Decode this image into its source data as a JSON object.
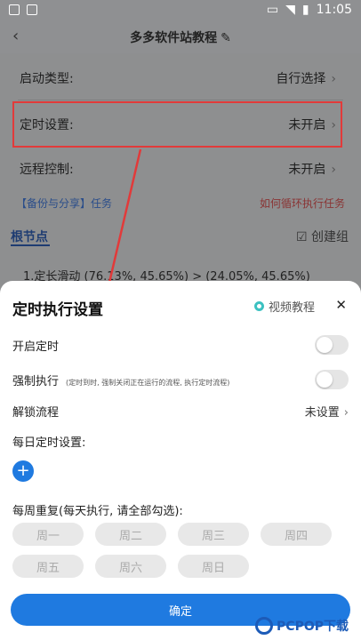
{
  "status_bar": {
    "time": "11:05"
  },
  "app_bar": {
    "title": "多多软件站教程"
  },
  "settings": {
    "startup_type_label": "启动类型:",
    "startup_type_value": "自行选择",
    "timer_label": "定时设置:",
    "timer_value": "未开启",
    "remote_label": "远程控制:",
    "remote_value": "未开启"
  },
  "links": {
    "backup": "【备份与分享】任务",
    "loop": "如何循环执行任务"
  },
  "tree": {
    "root_label": "根节点",
    "create_group": "创建组",
    "first_item": "1.定长滑动 (76.13%, 45.65%) > (24.05%, 45.65%)"
  },
  "sheet": {
    "title": "定时执行设置",
    "video_tutorial": "视频教程",
    "enable_timer": "开启定时",
    "force_exec": "强制执行",
    "force_exec_hint": "(定时到时, 强制关闭正在运行的流程, 执行定时流程)",
    "unlock_flow": "解锁流程",
    "unlock_value": "未设置",
    "daily_timer": "每日定时设置:",
    "weekly_repeat": "每周重复(每天执行, 请全部勾选):",
    "days": [
      "周一",
      "周二",
      "周三",
      "周四",
      "周五",
      "周六",
      "周日"
    ],
    "confirm": "确定"
  },
  "watermark": {
    "text": "PCPOP下载"
  },
  "colors": {
    "accent": "#1f7ae0",
    "highlight": "#e23a3a"
  }
}
